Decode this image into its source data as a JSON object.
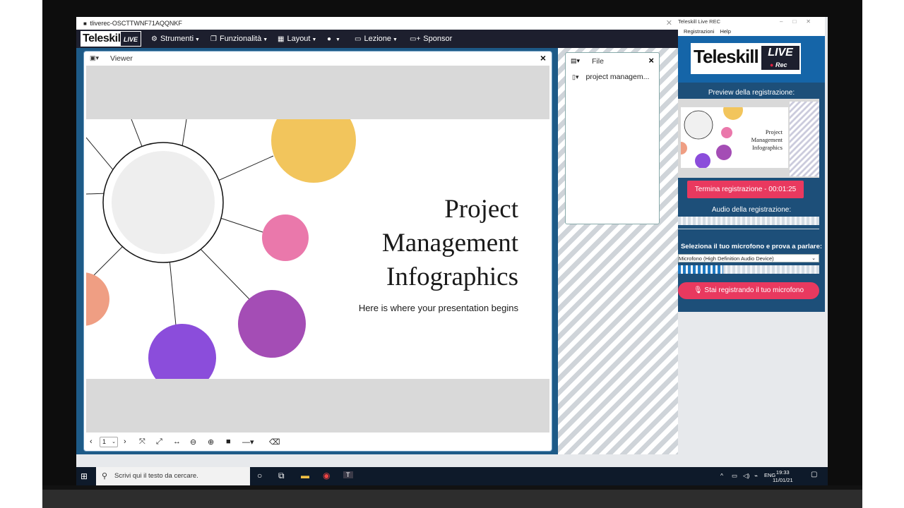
{
  "main_window": {
    "title": "tliverec-OSCTTWNF71AQQNKF",
    "logo_text": "Teleskill",
    "logo_badge": "LIVE",
    "menu": {
      "strumenti": "Strumenti",
      "funzionalita": "Funzionalità",
      "layout": "Layout",
      "lezione": "Lezione",
      "sponsor": "Sponsor"
    }
  },
  "viewer": {
    "label": "Viewer",
    "page_number": "1",
    "slide": {
      "title_line1": "Project",
      "title_line2": "Management",
      "title_line3": "Infographics",
      "subtitle": "Here is where your presentation begins"
    }
  },
  "files": {
    "label": "File",
    "item": "project managem..."
  },
  "recorder": {
    "title": "Teleskill Live REC",
    "menu_registrazioni": "Registrazioni",
    "menu_help": "Help",
    "logo_text": "Teleskill",
    "logo_live": "LIVE",
    "logo_rec": "Rec",
    "preview_label": "Preview della registrazione:",
    "stop_button": "Termina registrazione - 00:01:25",
    "audio_label": "Audio della registrazione:",
    "audio_level": 0.0,
    "mic_label": "Seleziona il tuo microfono e prova a parlare:",
    "mic_device": "Microfono (High Definition Audio Device)",
    "mic_level": 0.32,
    "mic_button": "Stai registrando il tuo microfono"
  },
  "taskbar": {
    "search_placeholder": "Scrivi qui il testo da cercare.",
    "language": "ENG",
    "time": "19:33",
    "date": "11/01/21"
  }
}
